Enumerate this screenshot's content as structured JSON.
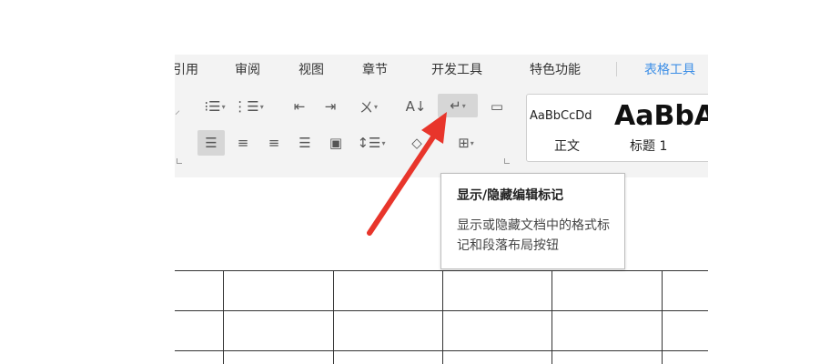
{
  "menu": {
    "tabs": [
      {
        "label": "引用"
      },
      {
        "label": "审阅"
      },
      {
        "label": "视图"
      },
      {
        "label": "章节"
      },
      {
        "label": "开发工具"
      },
      {
        "label": "特色功能"
      },
      {
        "label": "表格工具",
        "active": true
      }
    ]
  },
  "styles": {
    "sample1": "AaBbCcDd",
    "sample2": "AaBbA",
    "name1": "正文",
    "name2": "标题 1"
  },
  "toolbar": {
    "row1": [
      "bullet-list-icon",
      "numbered-list-icon",
      "decrease-indent-icon",
      "increase-indent-icon",
      "chinese-layout-icon",
      "sort-icon",
      "show-hide-marks-icon",
      "table-grid-icon"
    ],
    "row2": [
      "align-left-icon",
      "align-center-icon",
      "align-right-icon",
      "justify-icon",
      "distribute-icon",
      "line-spacing-icon",
      "shading-icon",
      "borders-icon"
    ],
    "glyphs": {
      "bullet": "⁝☰",
      "numbered": "⋮☰",
      "decrease": "⇤",
      "increase": "⇥",
      "chinese_layout": "ㄨ",
      "sort": "A↓",
      "show_hide": "↵",
      "grid": "▭",
      "align_left": "☰",
      "align_center": "≡",
      "align_right": "≡",
      "justify": "☰",
      "distribute": "▣",
      "line_spacing": "↕☰",
      "shading": "◇",
      "borders": "⊞",
      "dropdown": "▾"
    }
  },
  "tooltip": {
    "title": "显示/隐藏编辑标记",
    "description": "显示或隐藏文档中的格式标记和段落布局按钮"
  },
  "colors": {
    "accent": "#3c8ee6",
    "annotation_arrow": "#e8352b",
    "ribbon_bg": "#f3f3f3"
  }
}
